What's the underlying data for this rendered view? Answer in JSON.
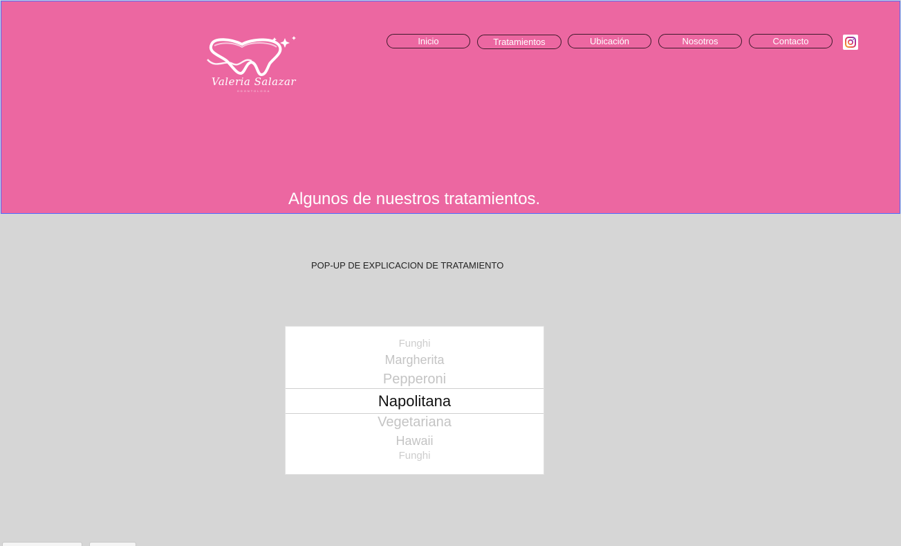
{
  "header": {
    "logo": {
      "script_text": "Valeria Salazar",
      "sub_text": "ODONTOLOGA"
    },
    "nav": [
      {
        "label": "Inicio",
        "icon": "none"
      },
      {
        "label": "Tratamientos",
        "icon": "none"
      },
      {
        "label": "Ubicación",
        "icon": "none"
      },
      {
        "label": "Nosotros",
        "icon": "none"
      },
      {
        "label": "Contacto",
        "icon": "none"
      }
    ],
    "social_icon": "instagram-icon",
    "hero_title": "Algunos de nuestros tratamientos."
  },
  "main": {
    "popup_text": "POP-UP DE EXPLICACION DE TRATAMIENTO",
    "picker": {
      "items": [
        "Funghi",
        "Margherita",
        "Pepperoni",
        "Napolitana",
        "Vegetariana",
        "Hawaii",
        "Funghi"
      ],
      "selected": "Napolitana"
    }
  },
  "colors": {
    "header_bg": "#ec67a1",
    "page_bg": "#d6d6d6",
    "accent_border": "#4b6bff"
  }
}
